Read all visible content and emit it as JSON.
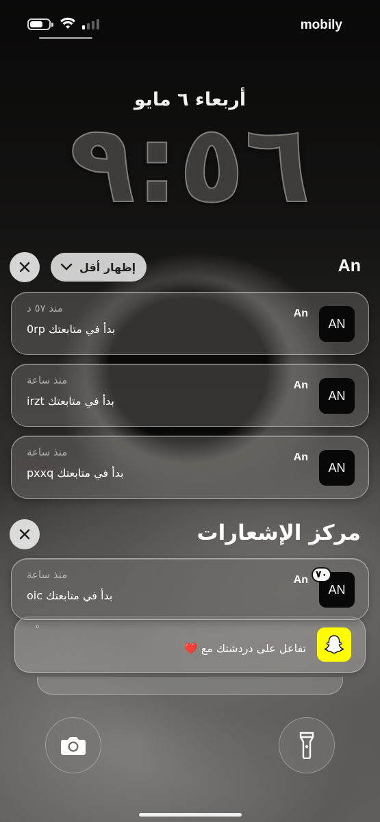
{
  "status_bar": {
    "carrier": "mobily",
    "battery_icon": "battery-icon",
    "wifi_icon": "wifi-icon",
    "signal_icon": "cellular-signal-icon"
  },
  "lock_screen": {
    "date": "أربعاء ٦ مايو",
    "time": "٩:٥٦"
  },
  "group": {
    "app_name": "An",
    "show_less_label": "إظهار أقل",
    "notifications": [
      {
        "app_icon_text": "AN",
        "sender": "An",
        "time": "منذ ٥٧ د",
        "body": "بدأ في متابعتك 0rp"
      },
      {
        "app_icon_text": "AN",
        "sender": "An",
        "time": "منذ ساعة",
        "body": "بدأ في متابعتك irzt"
      },
      {
        "app_icon_text": "AN",
        "sender": "An",
        "time": "منذ ساعة",
        "body": "بدأ في متابعتك pxxq"
      }
    ]
  },
  "notification_center": {
    "title": "مركز الإشعارات",
    "first": {
      "app_icon_text": "AN",
      "badge": "٧٠",
      "sender": "An",
      "time": "منذ ساعة",
      "body": "بدأ في متابعتك oic"
    },
    "snapchat": {
      "body": "تفاعل على دردشتك مع ❤️",
      "faint": "ه"
    }
  },
  "quick_actions": {
    "camera_icon": "camera-icon",
    "flashlight_icon": "flashlight-icon"
  }
}
